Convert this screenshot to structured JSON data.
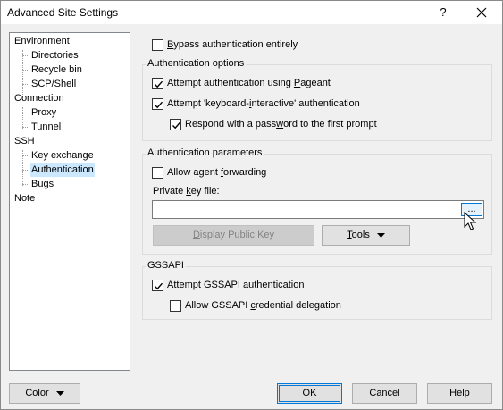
{
  "window": {
    "title": "Advanced Site Settings",
    "help_label": "?"
  },
  "tree": {
    "items": [
      {
        "label": "Environment",
        "level": 0
      },
      {
        "label": "Directories",
        "level": 1
      },
      {
        "label": "Recycle bin",
        "level": 1
      },
      {
        "label": "SCP/Shell",
        "level": 1
      },
      {
        "label": "Connection",
        "level": 0
      },
      {
        "label": "Proxy",
        "level": 1
      },
      {
        "label": "Tunnel",
        "level": 1
      },
      {
        "label": "SSH",
        "level": 0
      },
      {
        "label": "Key exchange",
        "level": 1
      },
      {
        "label": "Authentication",
        "level": 1,
        "selected": true
      },
      {
        "label": "Bugs",
        "level": 1
      },
      {
        "label": "Note",
        "level": 0
      }
    ]
  },
  "bypass": {
    "pre": "",
    "accel": "B",
    "post": "ypass authentication entirely",
    "checked": false
  },
  "auth_options": {
    "title": "Authentication options",
    "pageant": {
      "pre": "Attempt authentication using ",
      "accel": "P",
      "post": "ageant",
      "checked": true
    },
    "keyboard": {
      "pre": "Attempt 'keyboard-",
      "accel": "i",
      "post": "nteractive' authentication",
      "checked": true
    },
    "respond": {
      "pre": "Respond with a pass",
      "accel": "w",
      "post": "ord to the first prompt",
      "checked": true
    }
  },
  "auth_params": {
    "title": "Authentication parameters",
    "agent_forwarding": {
      "pre": "Allow agent ",
      "accel": "f",
      "post": "orwarding",
      "checked": false
    },
    "private_key": {
      "pre": "Private ",
      "accel": "k",
      "post": "ey file:",
      "value": ""
    },
    "browse_label": "...",
    "display_key": {
      "pre": "",
      "accel": "D",
      "post": "isplay Public Key"
    },
    "tools": {
      "pre": "",
      "accel": "T",
      "post": "ools"
    }
  },
  "gssapi": {
    "title": "GSSAPI",
    "attempt": {
      "pre": "Attempt ",
      "accel": "G",
      "post": "SSAPI authentication",
      "checked": true
    },
    "delegation": {
      "pre": "Allow GSSAPI ",
      "accel": "c",
      "post": "redential delegation",
      "checked": false
    }
  },
  "footer": {
    "color": {
      "pre": "",
      "accel": "C",
      "post": "olor"
    },
    "ok": "OK",
    "cancel": "Cancel",
    "help": {
      "pre": "",
      "accel": "H",
      "post": "elp"
    }
  }
}
